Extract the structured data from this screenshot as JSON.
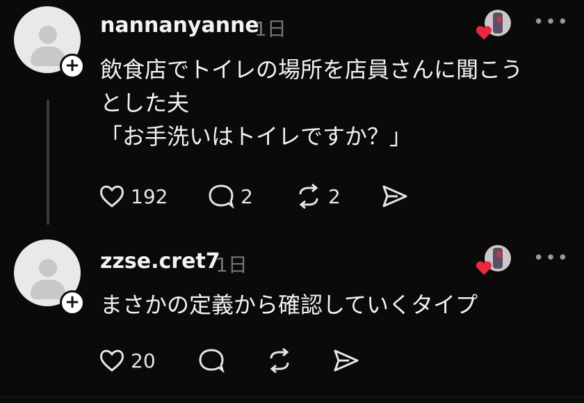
{
  "posts": [
    {
      "username": "nannanyanne",
      "time": "1日",
      "text": "飲食店でトイレの場所を店員さんに聞こう\nとした夫\n「お手洗いはトイレですか？」",
      "likes": "192",
      "comments": "2",
      "reposts": "2"
    },
    {
      "username": "zzse.cret7",
      "time": "1日",
      "text": "まさかの定義から確認していくタイプ",
      "likes": "20"
    }
  ],
  "icons": {
    "avatar": "person-placeholder-icon",
    "follow": "plus-icon",
    "more": "more-dots-icon",
    "like": "heart-icon",
    "comment": "comment-bubble-icon",
    "repost": "repost-icon",
    "share": "send-icon",
    "badge": "heart-badge-icon"
  },
  "colors": {
    "background": "#0a0a0a",
    "heart_badge": "#e8283f",
    "muted_text": "#777777"
  }
}
